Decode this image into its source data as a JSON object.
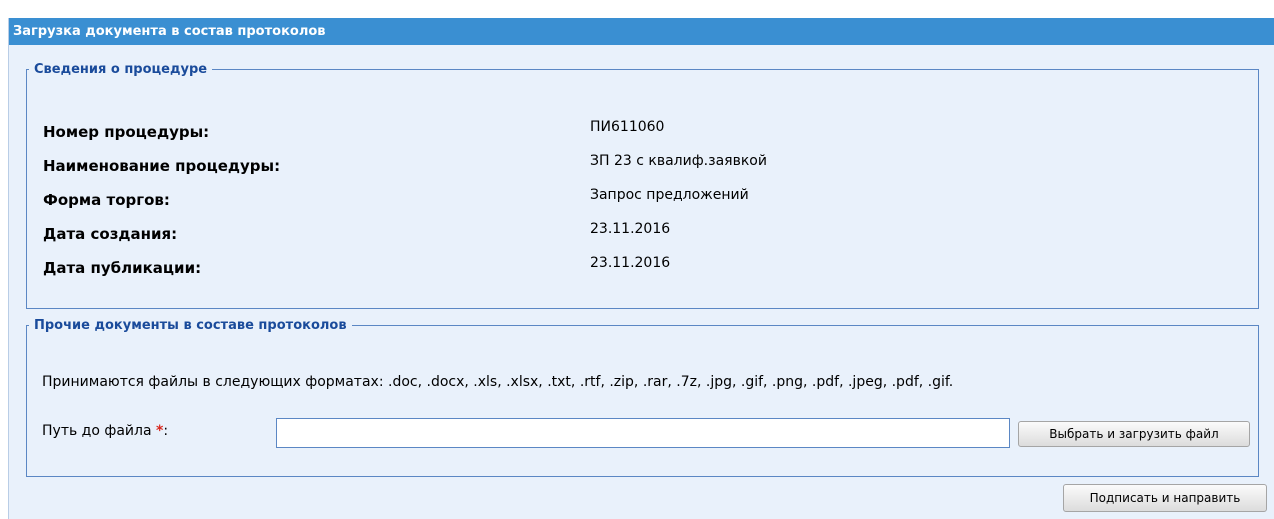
{
  "window": {
    "title": "Загрузка документа в состав протоколов"
  },
  "procedure": {
    "legend": "Сведения о процедуре",
    "fields": [
      {
        "label": "Номер процедуры:",
        "value": "ПИ611060"
      },
      {
        "label": "Наименование процедуры:",
        "value": "ЗП 23 с квалиф.заявкой"
      },
      {
        "label": "Форма торгов:",
        "value": "Запрос предложений"
      },
      {
        "label": "Дата создания:",
        "value": "23.11.2016"
      },
      {
        "label": "Дата публикации:",
        "value": "23.11.2016"
      }
    ]
  },
  "documents": {
    "legend": "Прочие документы в составе протоколов",
    "formats_text": "Принимаются файлы в следующих форматах: .doc, .docx, .xls, .xlsx, .txt, .rtf, .zip, .rar, .7z, .jpg, .gif, .png, .pdf, .jpeg, .pdf, .gif.",
    "path_label": "Путь до файла",
    "required_mark": "*",
    "path_colon": ":",
    "path_value": "",
    "upload_button": "Выбрать и загрузить файл"
  },
  "footer": {
    "sign_button": "Подписать и направить"
  },
  "colors": {
    "titlebar": "#3a8fd2",
    "panel": "#e9f1fb",
    "legend": "#1a4b9b",
    "required": "#d9261c"
  }
}
